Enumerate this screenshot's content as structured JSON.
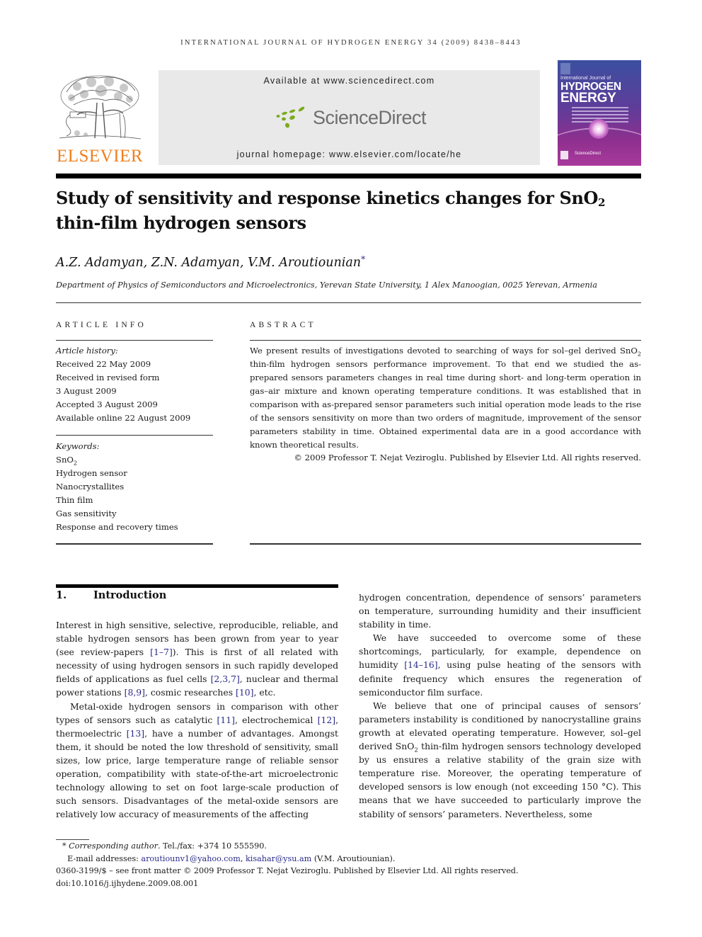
{
  "running_head": "INTERNATIONAL JOURNAL OF HYDROGEN ENERGY 34 (2009) 8438–8443",
  "publisher": {
    "logo_text": "ELSEVIER",
    "logo_color": "#f07e1e"
  },
  "sciencedirect_banner": {
    "available_text": "Available at www.sciencedirect.com",
    "logo_text": "ScienceDirect",
    "logo_dot_color": "#7bab1f",
    "homepage_text": "journal homepage: www.elsevier.com/locate/he"
  },
  "journal_cover": {
    "line1": "International Journal of",
    "line2": "HYDROGEN",
    "line3": "ENERGY",
    "footer": "ScienceDirect"
  },
  "article": {
    "title_main": "Study of sensitivity and response kinetics changes for SnO",
    "title_sub": "2",
    "title_line2": "thin-film hydrogen sensors",
    "authors": "A.Z. Adamyan, Z.N. Adamyan, V.M. Aroutiounian",
    "author_mark": "*",
    "affiliation": "Department of Physics of Semiconductors and Microelectronics, Yerevan State University, 1 Alex Manoogian, 0025 Yerevan, Armenia"
  },
  "article_info": {
    "heading": "ARTICLE INFO",
    "history_label": "Article history:",
    "history": [
      "Received 22 May 2009",
      "Received in revised form",
      "3 August 2009",
      "Accepted 3 August 2009",
      "Available online 22 August 2009"
    ],
    "keywords_label": "Keywords:",
    "keyword_sno2_main": "SnO",
    "keyword_sno2_sub": "2",
    "keywords": [
      "Hydrogen sensor",
      "Nanocrystallites",
      "Thin film",
      "Gas sensitivity",
      "Response and recovery times"
    ]
  },
  "abstract": {
    "heading": "ABSTRACT",
    "text_a": "We present results of investigations devoted to searching of ways for sol–gel derived SnO",
    "text_sub": "2",
    "text_b": " thin-film hydrogen sensors performance improvement. To that end we studied the as-prepared sensors parameters changes in real time during short- and long-term operation in gas–air mixture and known operating temperature conditions. It was established that in comparison with as-prepared sensor parameters such initial operation mode leads to the rise of the sensors sensitivity on more than two orders of magnitude, improvement of the sensor parameters stability in time. Obtained experimental data are in a good accordance with known theoretical results.",
    "copyright": "© 2009 Professor T. Nejat Veziroglu. Published by Elsevier Ltd. All rights reserved."
  },
  "introduction": {
    "number": "1.",
    "heading": "Introduction",
    "p1": [
      "Interest in high sensitive, selective, reproducible, reliable, and stable hydrogen sensors has been grown from year to year (see review-papers ",
      "[1–7]",
      "). This is first of all related with necessity of using hydrogen sensors in such rapidly developed fields of applications as fuel cells ",
      "[2,3,7]",
      ", nuclear and thermal power stations ",
      "[8,9]",
      ", cosmic researches ",
      "[10]",
      ", etc."
    ],
    "p2": [
      "Metal-oxide hydrogen sensors in comparison with other types of sensors such as catalytic ",
      "[11]",
      ", electrochemical ",
      "[12]",
      ", thermoelectric ",
      "[13]",
      ", have a number of advantages. Amongst them, it should be noted the low threshold of sensitivity, small sizes, low price, large temperature range of reliable sensor operation, compatibility with state-of-the-art microelectronic technology allowing to set on foot large-scale production of such sensors. Disadvantages of the metal-oxide sensors are relatively low accuracy of measurements of the affecting"
    ],
    "p3": "hydrogen concentration, dependence of sensors’ parameters on temperature, surrounding humidity and their insufficient stability in time.",
    "p4": [
      "We have succeeded to overcome some of these shortcomings, particularly, for example, dependence on humidity ",
      "[14–16]",
      ", using pulse heating of the sensors with definite frequency which ensures the regeneration of semiconductor film surface."
    ],
    "p5": [
      "We believe that one of principal causes of sensors’ parameters instability is conditioned by nanocrystalline grains growth at elevated operating temperature. However, sol–gel derived SnO",
      "2",
      " thin-film hydrogen sensors technology developed by us ensures a relative stability of the grain size with temperature rise. Moreover, the operating temperature of developed sensors is low enough (not exceeding 150 °C). This means that we have succeeded to particularly improve the stability of sensors’ parameters. Nevertheless, some"
    ]
  },
  "footnotes": {
    "mark": "*",
    "corresponding_label": "Corresponding author",
    "tel": ". Tel./fax: +374 10 555590.",
    "email_label": "E-mail addresses: ",
    "email1": "aroutiounv1@yahoo.com",
    "email_sep": ", ",
    "email2": "kisahar@ysu.am",
    "email_owner": " (V.M. Aroutiounian).",
    "issn_line": "0360-3199/$ – see front matter © 2009 Professor T. Nejat Veziroglu. Published by Elsevier Ltd. All rights reserved.",
    "doi": "doi:10.1016/j.ijhydene.2009.08.001"
  },
  "colors": {
    "link": "#2b2b8a",
    "rule": "#000000",
    "banner_bg": "#e9e9e9"
  }
}
